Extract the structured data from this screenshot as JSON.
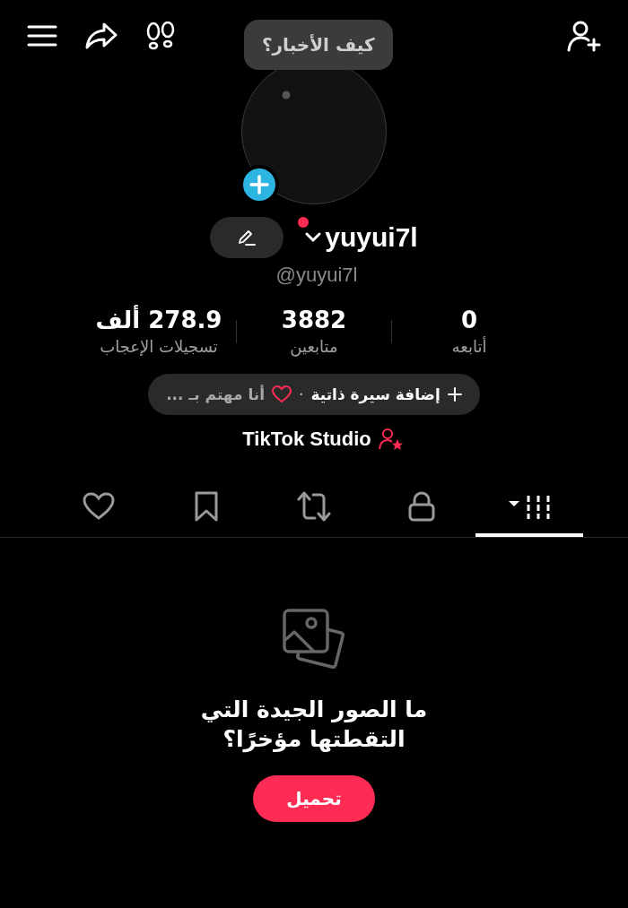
{
  "bubble": {
    "text": "كيف الأخبار؟"
  },
  "profile": {
    "name": "yuyui7l",
    "handle": "@yuyui7l",
    "has_notification": true
  },
  "stats": [
    {
      "value": "0",
      "label": "أتابعه"
    },
    {
      "value": "3882",
      "label": "متابعين"
    },
    {
      "value": "278.9 ألف",
      "label": "تسجيلات الإعجاب"
    }
  ],
  "bio_pill": {
    "add_bio": "إضافة سيرة ذاتية",
    "separator": "·",
    "interests": "أنا مهتم بـ ..."
  },
  "studio_link": "TikTok Studio",
  "tabs": [
    {
      "kind": "grid",
      "selected": true
    },
    {
      "kind": "private",
      "selected": false
    },
    {
      "kind": "reposts",
      "selected": false
    },
    {
      "kind": "saved",
      "selected": false
    },
    {
      "kind": "liked",
      "selected": false
    }
  ],
  "empty_state": {
    "message": "ما الصور الجيدة التي التقطتها مؤخرًا؟",
    "button": "تحميل"
  }
}
